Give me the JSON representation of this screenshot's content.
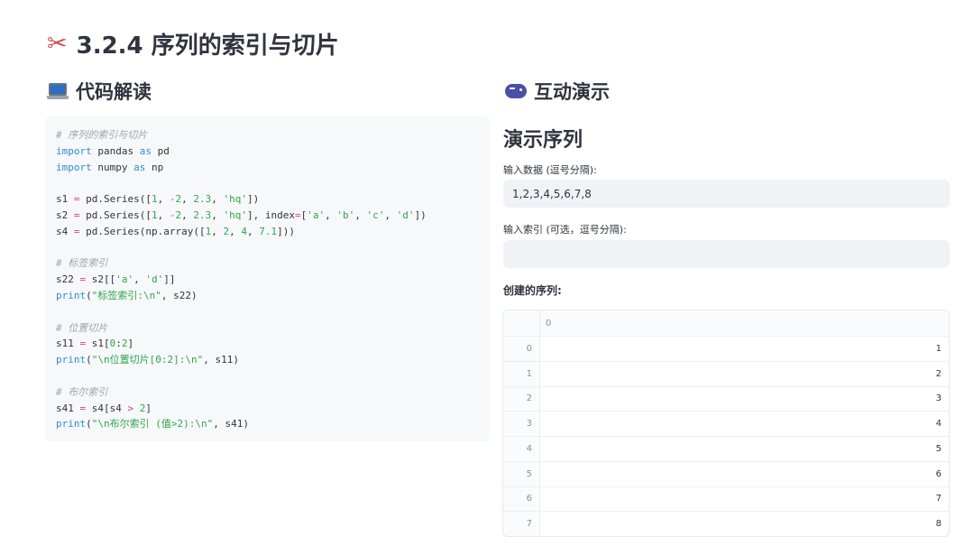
{
  "title": {
    "text": "3.2.4 序列的索引与切片",
    "icon": "scissors-icon"
  },
  "code_section": {
    "heading": "代码解读",
    "icon": "laptop-icon",
    "lines": [
      [
        {
          "t": "comment",
          "v": "# 序列的索引与切片"
        }
      ],
      [
        {
          "t": "kw",
          "v": "import"
        },
        {
          "t": "plain",
          "v": " pandas "
        },
        {
          "t": "kw",
          "v": "as"
        },
        {
          "t": "plain",
          "v": " pd"
        }
      ],
      [
        {
          "t": "kw",
          "v": "import"
        },
        {
          "t": "plain",
          "v": " numpy "
        },
        {
          "t": "kw",
          "v": "as"
        },
        {
          "t": "plain",
          "v": " np"
        }
      ],
      [
        {
          "t": "plain",
          "v": ""
        }
      ],
      [
        {
          "t": "plain",
          "v": "s1 "
        },
        {
          "t": "op",
          "v": "="
        },
        {
          "t": "plain",
          "v": " pd.Series(["
        },
        {
          "t": "num",
          "v": "1"
        },
        {
          "t": "plain",
          "v": ", "
        },
        {
          "t": "op",
          "v": "-"
        },
        {
          "t": "num",
          "v": "2"
        },
        {
          "t": "plain",
          "v": ", "
        },
        {
          "t": "num",
          "v": "2.3"
        },
        {
          "t": "plain",
          "v": ", "
        },
        {
          "t": "str",
          "v": "'hq'"
        },
        {
          "t": "plain",
          "v": "])"
        }
      ],
      [
        {
          "t": "plain",
          "v": "s2 "
        },
        {
          "t": "op",
          "v": "="
        },
        {
          "t": "plain",
          "v": " pd.Series(["
        },
        {
          "t": "num",
          "v": "1"
        },
        {
          "t": "plain",
          "v": ", "
        },
        {
          "t": "op",
          "v": "-"
        },
        {
          "t": "num",
          "v": "2"
        },
        {
          "t": "plain",
          "v": ", "
        },
        {
          "t": "num",
          "v": "2.3"
        },
        {
          "t": "plain",
          "v": ", "
        },
        {
          "t": "str",
          "v": "'hq'"
        },
        {
          "t": "plain",
          "v": "], index"
        },
        {
          "t": "op",
          "v": "="
        },
        {
          "t": "plain",
          "v": "["
        },
        {
          "t": "str",
          "v": "'a'"
        },
        {
          "t": "plain",
          "v": ", "
        },
        {
          "t": "str",
          "v": "'b'"
        },
        {
          "t": "plain",
          "v": ", "
        },
        {
          "t": "str",
          "v": "'c'"
        },
        {
          "t": "plain",
          "v": ", "
        },
        {
          "t": "str",
          "v": "'d'"
        },
        {
          "t": "plain",
          "v": "])"
        }
      ],
      [
        {
          "t": "plain",
          "v": "s4 "
        },
        {
          "t": "op",
          "v": "="
        },
        {
          "t": "plain",
          "v": " pd.Series(np.array(["
        },
        {
          "t": "num",
          "v": "1"
        },
        {
          "t": "plain",
          "v": ", "
        },
        {
          "t": "num",
          "v": "2"
        },
        {
          "t": "plain",
          "v": ", "
        },
        {
          "t": "num",
          "v": "4"
        },
        {
          "t": "plain",
          "v": ", "
        },
        {
          "t": "num",
          "v": "7.1"
        },
        {
          "t": "plain",
          "v": "]))"
        }
      ],
      [
        {
          "t": "plain",
          "v": ""
        }
      ],
      [
        {
          "t": "comment",
          "v": "# 标签索引"
        }
      ],
      [
        {
          "t": "plain",
          "v": "s22 "
        },
        {
          "t": "op",
          "v": "="
        },
        {
          "t": "plain",
          "v": " s2[["
        },
        {
          "t": "str",
          "v": "'a'"
        },
        {
          "t": "plain",
          "v": ", "
        },
        {
          "t": "str",
          "v": "'d'"
        },
        {
          "t": "plain",
          "v": "]]"
        }
      ],
      [
        {
          "t": "kw",
          "v": "print"
        },
        {
          "t": "plain",
          "v": "("
        },
        {
          "t": "str",
          "v": "\"标签索引:\\n\""
        },
        {
          "t": "plain",
          "v": ", s22)"
        }
      ],
      [
        {
          "t": "plain",
          "v": ""
        }
      ],
      [
        {
          "t": "comment",
          "v": "# 位置切片"
        }
      ],
      [
        {
          "t": "plain",
          "v": "s11 "
        },
        {
          "t": "op",
          "v": "="
        },
        {
          "t": "plain",
          "v": " s1["
        },
        {
          "t": "num",
          "v": "0"
        },
        {
          "t": "plain",
          "v": ":"
        },
        {
          "t": "num",
          "v": "2"
        },
        {
          "t": "plain",
          "v": "]"
        }
      ],
      [
        {
          "t": "kw",
          "v": "print"
        },
        {
          "t": "plain",
          "v": "("
        },
        {
          "t": "str",
          "v": "\"\\n位置切片[0:2]:\\n\""
        },
        {
          "t": "plain",
          "v": ", s11)"
        }
      ],
      [
        {
          "t": "plain",
          "v": ""
        }
      ],
      [
        {
          "t": "comment",
          "v": "# 布尔索引"
        }
      ],
      [
        {
          "t": "plain",
          "v": "s41 "
        },
        {
          "t": "op",
          "v": "="
        },
        {
          "t": "plain",
          "v": " s4[s4 "
        },
        {
          "t": "op",
          "v": ">"
        },
        {
          "t": "plain",
          "v": " "
        },
        {
          "t": "num",
          "v": "2"
        },
        {
          "t": "plain",
          "v": "]"
        }
      ],
      [
        {
          "t": "kw",
          "v": "print"
        },
        {
          "t": "plain",
          "v": "("
        },
        {
          "t": "str",
          "v": "\"\\n布尔索引 (值>2):\\n\""
        },
        {
          "t": "plain",
          "v": ", s41)"
        }
      ]
    ]
  },
  "demo_section": {
    "heading": "互动演示",
    "icon": "gamepad-icon",
    "subtitle": "演示序列",
    "data_input": {
      "label": "输入数据 (逗号分隔):",
      "value": "1,2,3,4,5,6,7,8",
      "placeholder": ""
    },
    "index_input": {
      "label": "输入索引 (可选，逗号分隔):",
      "value": "",
      "placeholder": ""
    },
    "table_heading": "创建的序列:",
    "table": {
      "column": "0",
      "rows": [
        {
          "index": "0",
          "value": "1"
        },
        {
          "index": "1",
          "value": "2"
        },
        {
          "index": "2",
          "value": "3"
        },
        {
          "index": "3",
          "value": "4"
        },
        {
          "index": "4",
          "value": "5"
        },
        {
          "index": "5",
          "value": "6"
        },
        {
          "index": "6",
          "value": "7"
        },
        {
          "index": "7",
          "value": "8"
        }
      ]
    }
  }
}
